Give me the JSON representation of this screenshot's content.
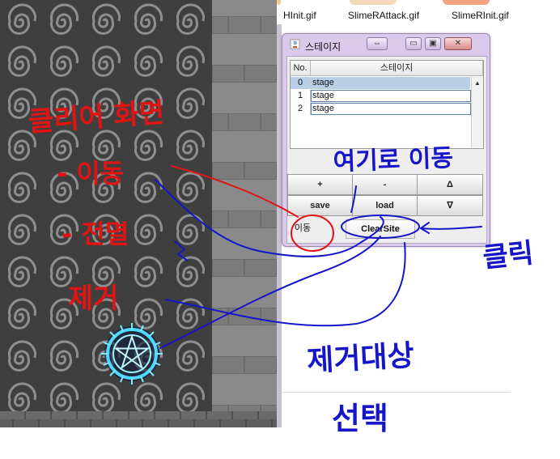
{
  "files": [
    {
      "name": "HInit.gif",
      "thumb_color": "#f4c88a"
    },
    {
      "name": "SlimeRAttack.gif",
      "thumb_color": "#f2b880"
    },
    {
      "name": "SlimeRInit.gif",
      "thumb_color": "#f08e6a"
    }
  ],
  "dialog": {
    "title": "스테이지",
    "title_buttons": {
      "move": "⇔",
      "minimize": "▭",
      "maximize": "▣",
      "close": "✕"
    },
    "table": {
      "columns": [
        "No.",
        "스테이지"
      ],
      "rows": [
        {
          "no": "0",
          "name": "stage",
          "selected": true
        },
        {
          "no": "1",
          "name": "stage",
          "selected": false
        },
        {
          "no": "2",
          "name": "stage",
          "selected": false
        }
      ]
    },
    "buttons": {
      "add": "+",
      "remove": "-",
      "up": "Δ",
      "save": "save",
      "load": "load",
      "down": "∇",
      "move": "이동",
      "clear_site": "ClearSite"
    }
  },
  "annotations": {
    "clear_screen": "클리어 화면",
    "move": "- 이동",
    "all_clear": "- 전멸",
    "remove": "제거",
    "move_here": "여기로 이동",
    "click": "클릭",
    "remove_target": "제거대상",
    "select": "선택",
    "colors": {
      "red": "#e11414",
      "blue": "#1616c8"
    }
  }
}
